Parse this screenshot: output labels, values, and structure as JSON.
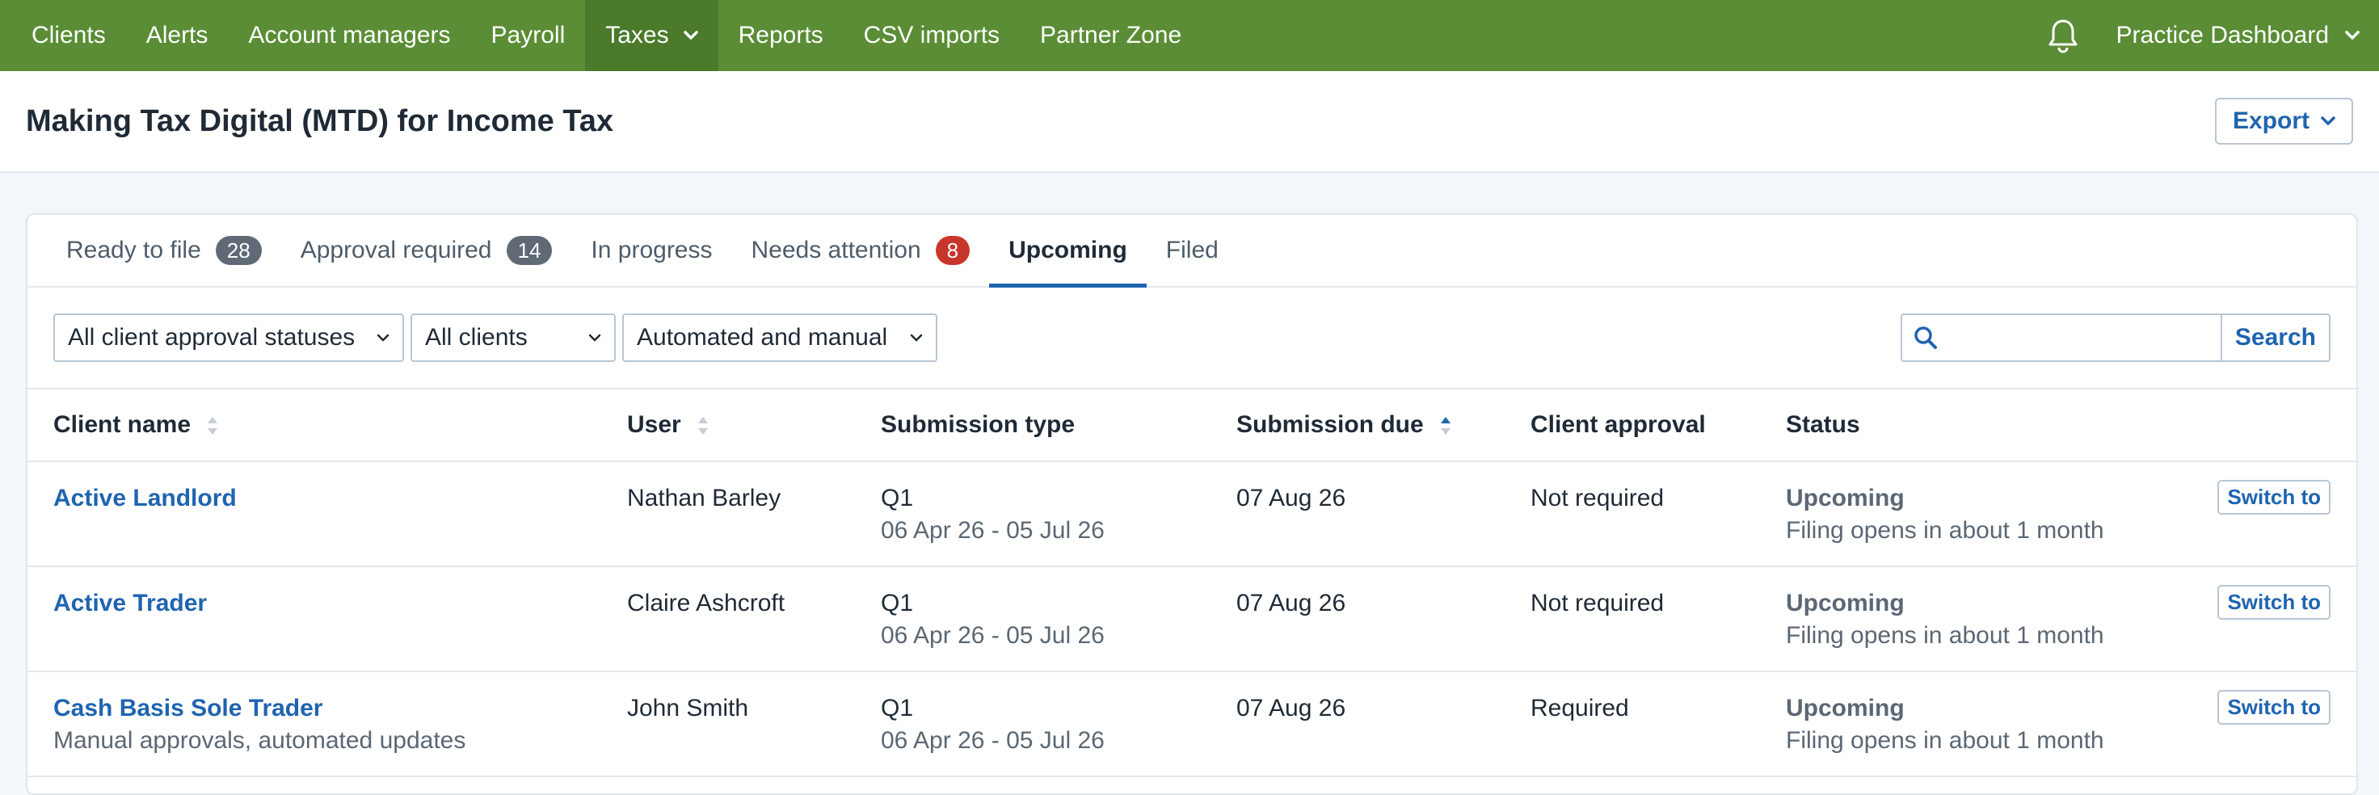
{
  "nav": {
    "items": [
      {
        "label": "Clients"
      },
      {
        "label": "Alerts"
      },
      {
        "label": "Account managers"
      },
      {
        "label": "Payroll"
      },
      {
        "label": "Taxes"
      },
      {
        "label": "Reports"
      },
      {
        "label": "CSV imports"
      },
      {
        "label": "Partner Zone"
      }
    ],
    "active_item": "Taxes",
    "right_label": "Practice Dashboard",
    "icons": {
      "notifications": "bell-icon",
      "dropdown": "chevron-down-icon"
    }
  },
  "page": {
    "title": "Making Tax Digital (MTD) for Income Tax",
    "export_label": "Export"
  },
  "tabs": [
    {
      "label": "Ready to file",
      "count": "28"
    },
    {
      "label": "Approval required",
      "count": "14"
    },
    {
      "label": "In progress"
    },
    {
      "label": "Needs attention",
      "count": "8"
    },
    {
      "label": "Upcoming"
    },
    {
      "label": "Filed"
    }
  ],
  "active_tab": "Upcoming",
  "filters": {
    "approval_status": "All client approval statuses",
    "clients": "All clients",
    "mode": "Automated and manual",
    "search_placeholder": "",
    "search_label": "Search"
  },
  "table": {
    "headers": {
      "client_name": "Client name",
      "user": "User",
      "submission_type": "Submission type",
      "submission_due": "Submission due",
      "client_approval": "Client approval",
      "status": "Status"
    },
    "switch_label": "Switch to",
    "rows": [
      {
        "client": "Active Landlord",
        "client_sub": "",
        "user": "Nathan Barley",
        "type": "Q1",
        "period": "06 Apr 26 - 05 Jul 26",
        "due": "07 Aug 26",
        "approval": "Not required",
        "status": "Upcoming",
        "status_detail": "Filing opens in about 1 month"
      },
      {
        "client": "Active Trader",
        "client_sub": "",
        "user": "Claire Ashcroft",
        "type": "Q1",
        "period": "06 Apr 26 - 05 Jul 26",
        "due": "07 Aug 26",
        "approval": "Not required",
        "status": "Upcoming",
        "status_detail": "Filing opens in about 1 month"
      },
      {
        "client": "Cash Basis Sole Trader",
        "client_sub": "Manual approvals, automated updates",
        "user": "John Smith",
        "type": "Q1",
        "period": "06 Apr 26 - 05 Jul 26",
        "due": "07 Aug 26",
        "approval": "Required",
        "status": "Upcoming",
        "status_detail": "Filing opens in about 1 month"
      }
    ]
  },
  "colors": {
    "nav_bg": "#5a8d35",
    "nav_active": "#4a7a2a",
    "link": "#1f64b0",
    "badge_grey": "#5f6a76",
    "badge_red": "#c8352b"
  }
}
